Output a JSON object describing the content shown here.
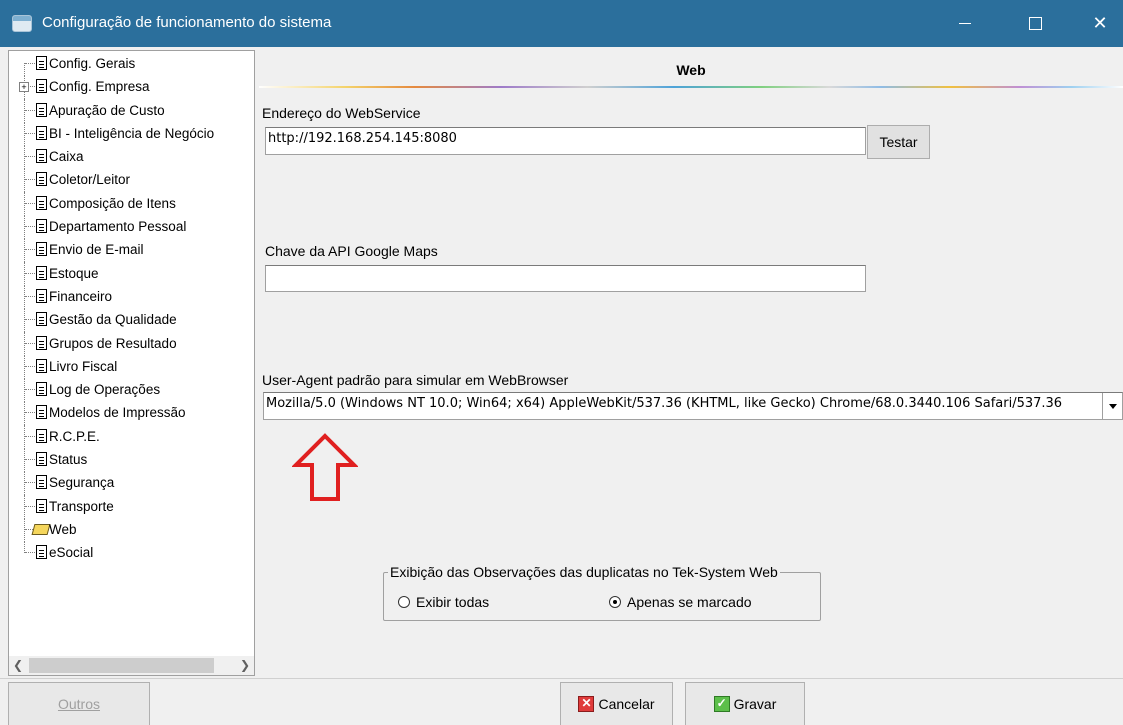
{
  "window": {
    "title": "Configuração de funcionamento do sistema",
    "minimize": "—",
    "maximize": "☐",
    "close": "✕"
  },
  "tree": {
    "items": [
      {
        "label": "Config. Gerais",
        "icon": "doc",
        "expandable": false
      },
      {
        "label": "Config. Empresa",
        "icon": "doc",
        "expandable": true
      },
      {
        "label": "Apuração de Custo",
        "icon": "doc",
        "expandable": false
      },
      {
        "label": "BI - Inteligência de Negócio",
        "icon": "doc",
        "expandable": false
      },
      {
        "label": "Caixa",
        "icon": "doc",
        "expandable": false
      },
      {
        "label": "Coletor/Leitor",
        "icon": "doc",
        "expandable": false
      },
      {
        "label": "Composição de Itens",
        "icon": "doc",
        "expandable": false
      },
      {
        "label": "Departamento Pessoal",
        "icon": "doc",
        "expandable": false
      },
      {
        "label": "Envio de E-mail",
        "icon": "doc",
        "expandable": false
      },
      {
        "label": "Estoque",
        "icon": "doc",
        "expandable": false
      },
      {
        "label": "Financeiro",
        "icon": "doc",
        "expandable": false
      },
      {
        "label": "Gestão da Qualidade",
        "icon": "doc",
        "expandable": false
      },
      {
        "label": "Grupos de Resultado",
        "icon": "doc",
        "expandable": false
      },
      {
        "label": "Livro Fiscal",
        "icon": "doc",
        "expandable": false
      },
      {
        "label": "Log de Operações",
        "icon": "doc",
        "expandable": false
      },
      {
        "label": "Modelos de Impressão",
        "icon": "doc",
        "expandable": false
      },
      {
        "label": "R.C.P.E.",
        "icon": "doc",
        "expandable": false
      },
      {
        "label": "Status",
        "icon": "doc",
        "expandable": false
      },
      {
        "label": "Segurança",
        "icon": "doc",
        "expandable": false
      },
      {
        "label": "Transporte",
        "icon": "doc",
        "expandable": false
      },
      {
        "label": "Web",
        "icon": "folder-open",
        "expandable": false,
        "selected": true
      },
      {
        "label": "eSocial",
        "icon": "doc",
        "expandable": false
      }
    ]
  },
  "panel": {
    "title": "Web",
    "webservice_label": "Endereço do WebService",
    "webservice_value": "http://192.168.254.145:8080",
    "test_button": "Testar",
    "maps_label": "Chave da API Google Maps",
    "maps_value": "",
    "useragent_label": "User-Agent padrão para simular em WebBrowser",
    "useragent_value": "Mozilla/5.0 (Windows NT 10.0; Win64; x64) AppleWebKit/537.36 (KHTML, like Gecko) Chrome/68.0.3440.106 Safari/537.36",
    "group_legend": "Exibição das Observações das duplicatas no Tek-System Web",
    "radio_all": "Exibir todas",
    "radio_marked": "Apenas se marcado",
    "radio_selected": "Apenas se marcado"
  },
  "footer": {
    "others": "Outros",
    "cancel": "Cancelar",
    "save": "Gravar"
  },
  "colors": {
    "titlebar": "#2b6f9c",
    "annotation_arrow": "#e02020"
  }
}
